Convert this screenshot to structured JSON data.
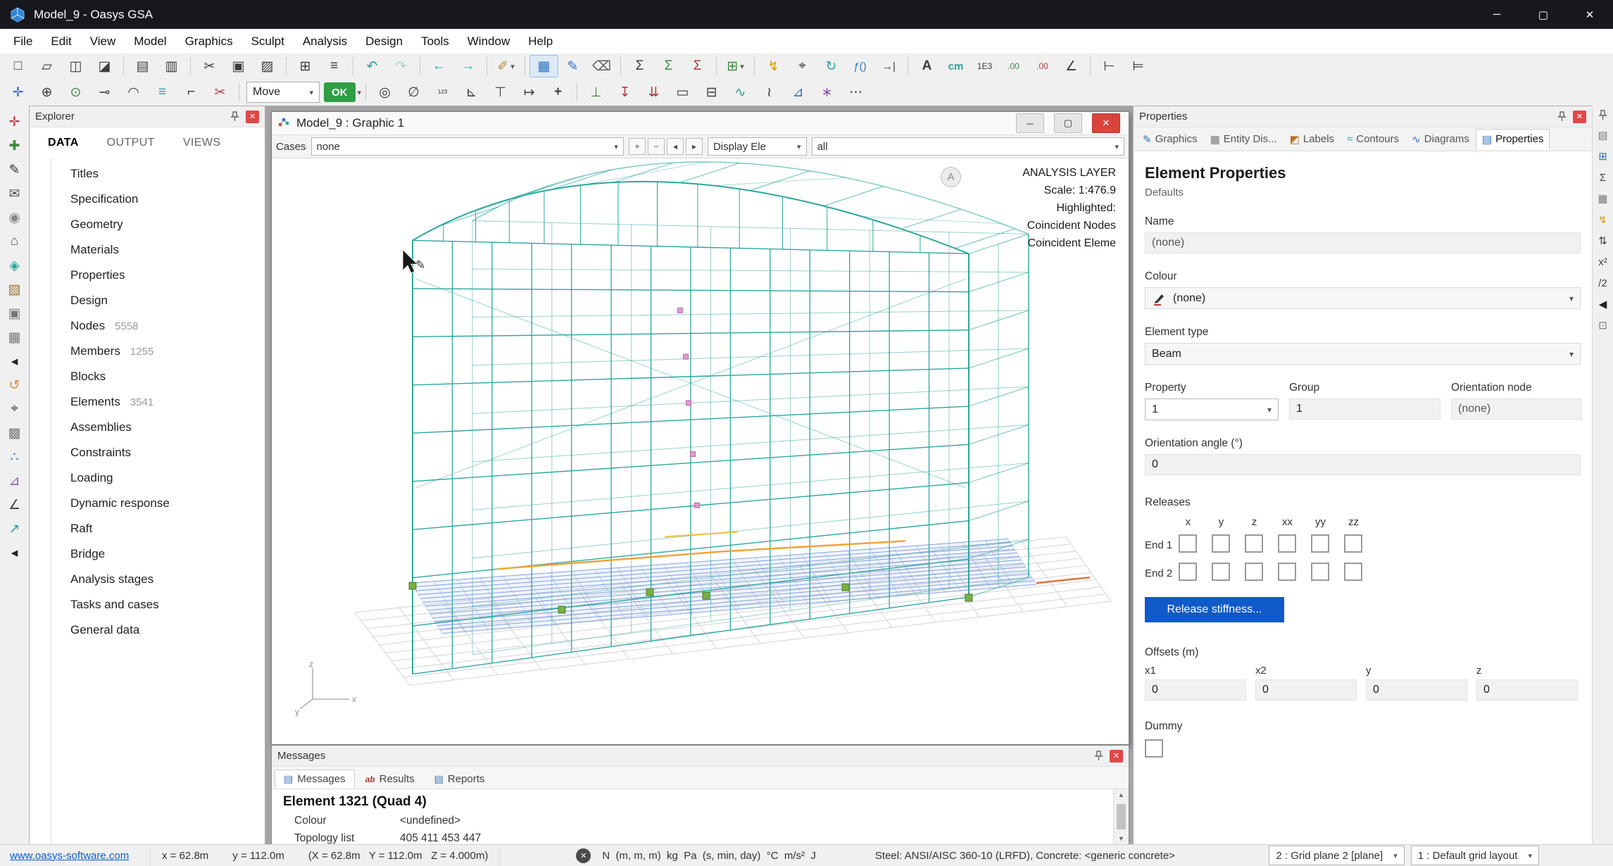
{
  "glyphs": {
    "dropdown": "▾",
    "expand": "▶",
    "close": "✕",
    "minimize": "─",
    "maximize": "▢",
    "scroll_up": "▲",
    "scroll_down": "▼"
  },
  "titlebar": {
    "title": "Model_9 - Oasys GSA"
  },
  "menubar": {
    "items": [
      "File",
      "Edit",
      "View",
      "Model",
      "Graphics",
      "Sculpt",
      "Analysis",
      "Design",
      "Tools",
      "Window",
      "Help"
    ]
  },
  "toolbar1": {
    "items": [
      {
        "name": "new-icon",
        "glyph": "□"
      },
      {
        "name": "open-icon",
        "glyph": "▱"
      },
      {
        "name": "save-icon",
        "glyph": "◫"
      },
      {
        "name": "save-all-icon",
        "glyph": "◪"
      },
      {
        "sep": true
      },
      {
        "name": "print-icon",
        "glyph": "▤"
      },
      {
        "name": "print-preview-icon",
        "glyph": "▥"
      },
      {
        "sep": true
      },
      {
        "name": "cut-icon",
        "glyph": "✂"
      },
      {
        "name": "copy-icon",
        "glyph": "▣"
      },
      {
        "name": "paste-icon",
        "glyph": "▨"
      },
      {
        "sep": true
      },
      {
        "name": "print-grid-icon",
        "glyph": "⊞"
      },
      {
        "name": "reports-icon",
        "glyph": "≡"
      },
      {
        "sep": true
      },
      {
        "name": "undo-icon",
        "glyph": "↶",
        "color": "#2aa49b"
      },
      {
        "name": "redo-icon",
        "glyph": "↷",
        "color": "#a9cfcb"
      },
      {
        "sep": true
      },
      {
        "name": "back-icon",
        "glyph": "←",
        "color": "#2aa49b"
      },
      {
        "name": "forward-icon",
        "glyph": "→",
        "color": "#2aa49b"
      },
      {
        "sep": true
      },
      {
        "name": "sweep-icon",
        "glyph": "✐",
        "color": "#b78a3c",
        "dd": true
      },
      {
        "sep": true
      },
      {
        "name": "table-view-icon",
        "glyph": "▦",
        "color": "#2f6fbe",
        "active": true
      },
      {
        "name": "draw-icon",
        "glyph": "✎",
        "color": "#2f6fbe"
      },
      {
        "name": "erase-icon",
        "glyph": "⌫",
        "color": "#555555"
      },
      {
        "sep": true
      },
      {
        "name": "sum-icon",
        "glyph": "Σ"
      },
      {
        "name": "sum-add-icon",
        "glyph": "Σ",
        "color": "#3c8a3c"
      },
      {
        "name": "sum-remove-icon",
        "glyph": "Σ",
        "color": "#b03a3a"
      },
      {
        "sep": true
      },
      {
        "name": "add-grid-icon",
        "glyph": "⊞",
        "color": "#3c8a3c",
        "dd": true
      },
      {
        "sep": true
      },
      {
        "name": "flash-icon",
        "glyph": "↯",
        "color": "#d99a00"
      },
      {
        "name": "find-icon",
        "glyph": "⌖"
      },
      {
        "name": "refresh-icon",
        "glyph": "↻",
        "color": "#2aa49b"
      },
      {
        "name": "function-icon",
        "glyph": "ƒ()",
        "size": 15,
        "color": "#2f6fbe"
      },
      {
        "name": "goto-end-icon",
        "glyph": "→|",
        "size": 15
      },
      {
        "sep": true
      },
      {
        "name": "font-icon",
        "glyph": "A",
        "bold": true
      },
      {
        "name": "units-cm-icon",
        "glyph": "cm",
        "size": 15,
        "color": "#2aa49b",
        "bold": true
      },
      {
        "name": "exponent-icon",
        "glyph": "1E3",
        "size": 12
      },
      {
        "name": "decimals-increase-icon",
        "glyph": ".00",
        "size": 12,
        "color": "#3c8a3c"
      },
      {
        "name": "decimals-decrease-icon",
        "glyph": ".00",
        "size": 12,
        "color": "#b03a3a"
      },
      {
        "name": "angle-units-icon",
        "glyph": "∠"
      },
      {
        "sep": true
      },
      {
        "name": "dock-left-icon",
        "glyph": "⊢"
      },
      {
        "name": "indent-icon",
        "glyph": "⊨"
      }
    ]
  },
  "toolbar2": {
    "move_label": "Move",
    "ok_label": "OK",
    "items_left": [
      {
        "name": "select-all-icon",
        "glyph": "✛",
        "color": "#2f6fbe"
      },
      {
        "name": "zoom-window-icon",
        "glyph": "⊕"
      },
      {
        "name": "add-node-icon",
        "glyph": "⊙",
        "color": "#3c8a3c"
      },
      {
        "name": "add-element-icon",
        "glyph": "⊸",
        "color": "#444444"
      },
      {
        "name": "add-arc-icon",
        "glyph": "◠",
        "color": "#444444"
      },
      {
        "name": "layers-icon",
        "glyph": "≡",
        "color": "#2aa49b"
      },
      {
        "name": "corner-snap-icon",
        "glyph": "⌐"
      },
      {
        "name": "trim-icon",
        "glyph": "✂",
        "color": "#b03a3a"
      },
      {
        "sep": true
      }
    ],
    "items_right": [
      {
        "sep": true
      },
      {
        "name": "origin-icon",
        "glyph": "◎"
      },
      {
        "name": "empty-set-icon",
        "glyph": "∅"
      },
      {
        "name": "renumber-icon",
        "glyph": "¹²³",
        "size": 13
      },
      {
        "name": "angle-measure-icon",
        "glyph": "⊾"
      },
      {
        "name": "tsquare-icon",
        "glyph": "⊤"
      },
      {
        "name": "extend-icon",
        "glyph": "↦"
      },
      {
        "name": "crosshair-icon",
        "glyph": "+",
        "bold": true
      },
      {
        "sep": true
      },
      {
        "name": "support-icon",
        "glyph": "⊥",
        "color": "#3c8a3c"
      },
      {
        "name": "load-down-icon",
        "glyph": "↧",
        "color": "#b03a3a"
      },
      {
        "name": "load-distributed-icon",
        "glyph": "⇊",
        "color": "#b03a3a"
      },
      {
        "name": "frame-icon",
        "glyph": "▭"
      },
      {
        "name": "remove-cell-icon",
        "glyph": "⊟"
      },
      {
        "name": "spring-icon",
        "glyph": "∿",
        "color": "#2aa49b"
      },
      {
        "name": "joint-icon",
        "glyph": "≀"
      },
      {
        "name": "rigid-link-icon",
        "glyph": "⊿",
        "color": "#2f6fbe"
      },
      {
        "name": "axes-icon",
        "glyph": "∗",
        "color": "#8a5ab0"
      },
      {
        "name": "more-tools-icon",
        "glyph": "⋯"
      }
    ]
  },
  "left_strip": [
    {
      "name": "modify-tool-icon",
      "glyph": "✛",
      "color": "#b03a3a"
    },
    {
      "name": "sculpt-tool-icon",
      "glyph": "✚",
      "color": "#3c8a3c"
    },
    {
      "name": "pencil-tool-icon",
      "glyph": "✎",
      "color": "#333333"
    },
    {
      "name": "mail-icon",
      "glyph": "✉",
      "color": "#555555"
    },
    {
      "name": "lock-icon",
      "glyph": "◉",
      "color": "#888888"
    },
    {
      "name": "home-icon",
      "glyph": "⌂",
      "color": "#555555"
    },
    {
      "name": "box-3d-icon",
      "glyph": "◈",
      "color": "#2aa49b"
    },
    {
      "name": "package-icon",
      "glyph": "▧",
      "color": "#a0722e"
    },
    {
      "name": "security-icon",
      "glyph": "▣",
      "color": "#777777"
    },
    {
      "name": "grid-tool-icon",
      "glyph": "▦",
      "color": "#777777"
    },
    {
      "name": "collapse-panel-icon",
      "glyph": "◂",
      "color": "#222222"
    },
    {
      "name": "rotate-view-icon",
      "glyph": "↺",
      "color": "#e08a2e"
    },
    {
      "name": "zoom-tool-icon",
      "glyph": "⌖",
      "color": "#444444"
    },
    {
      "name": "volume-icon",
      "glyph": "▩",
      "color": "#777777"
    },
    {
      "name": "nodes-tool-icon",
      "glyph": "∴",
      "color": "#2f6fbe"
    },
    {
      "name": "section-tool-icon",
      "glyph": "⊿",
      "color": "#8a5ab0"
    },
    {
      "name": "measure-icon",
      "glyph": "∠",
      "color": "#444444"
    },
    {
      "name": "pointer-ne-icon",
      "glyph": "↗",
      "color": "#2aa49b"
    },
    {
      "name": "collapse-panel2-icon",
      "glyph": "◂",
      "color": "#222222"
    }
  ],
  "right_strip": [
    {
      "name": "views-strip-icon",
      "glyph": "▤",
      "color": "#777777"
    },
    {
      "name": "grid-strip-icon",
      "glyph": "⊞",
      "color": "#2f6fbe"
    },
    {
      "name": "sum-strip-icon",
      "glyph": "Σ",
      "color": "#444444"
    },
    {
      "name": "table-strip-icon",
      "glyph": "▦",
      "color": "#777777"
    },
    {
      "name": "flash-strip-icon",
      "glyph": "↯",
      "color": "#d99a00"
    },
    {
      "name": "swap-strip-icon",
      "glyph": "⇅",
      "color": "#444444"
    },
    {
      "name": "x2-strip-icon",
      "glyph": "x²",
      "color": "#444444"
    },
    {
      "name": "half-strip-icon",
      "glyph": "/2",
      "color": "#444444"
    },
    {
      "name": "collapse-right-icon",
      "glyph": "◀",
      "color": "#222222"
    },
    {
      "name": "hash-strip-icon",
      "glyph": "⊡",
      "color": "#777777"
    }
  ],
  "explorer": {
    "title": "Explorer",
    "tabs": [
      "DATA",
      "OUTPUT",
      "VIEWS"
    ],
    "active_tab": "DATA",
    "items": [
      {
        "label": "Titles",
        "arrow": false
      },
      {
        "label": "Specification",
        "arrow": true
      },
      {
        "label": "Geometry",
        "arrow": true
      },
      {
        "label": "Materials",
        "arrow": true
      },
      {
        "label": "Properties",
        "arrow": true
      },
      {
        "label": "Design",
        "arrow": true
      },
      {
        "label": "Nodes",
        "arrow": false,
        "count": "5558"
      },
      {
        "label": "Members",
        "arrow": false,
        "count": "1255"
      },
      {
        "label": "Blocks",
        "arrow": false
      },
      {
        "label": "Elements",
        "arrow": false,
        "count": "3541"
      },
      {
        "label": "Assemblies",
        "arrow": false
      },
      {
        "label": "Constraints",
        "arrow": true
      },
      {
        "label": "Loading",
        "arrow": true
      },
      {
        "label": "Dynamic response",
        "arrow": true
      },
      {
        "label": "Raft",
        "arrow": true
      },
      {
        "label": "Bridge",
        "arrow": true
      },
      {
        "label": "Analysis stages",
        "arrow": true
      },
      {
        "label": "Tasks and cases",
        "arrow": true
      },
      {
        "label": "General data",
        "arrow": true
      }
    ]
  },
  "graphic_window": {
    "title": "Model_9 : Graphic 1",
    "cases_label": "Cases",
    "cases_value": "none",
    "nav_buttons": [
      "+",
      "−",
      "◂",
      "▸"
    ],
    "display_label": "Display Ele",
    "display_value": "all",
    "overlay": {
      "badge": "A",
      "layer": "ANALYSIS LAYER",
      "scale": "Scale: 1:476.9",
      "highlighted": "Highlighted:",
      "coincident_nodes": "Coincident Nodes",
      "coincident_elements": "Coincident Eleme"
    },
    "axis": {
      "x": "x",
      "y": "y",
      "z": "z"
    }
  },
  "model": {
    "colors": {
      "structure": "#2BA79D",
      "slab": "#5b86d8",
      "slab_fill": "#3f6fd1",
      "grid": "#cfcfcf",
      "highlight": "#f0a33a",
      "highlight_small": "#f0c03a",
      "highlight2": "#e2703a",
      "node": "#76b041",
      "node_border": "#4e7a2a",
      "marker": "#e09ad6",
      "marker_border": "#b36aa8"
    }
  },
  "messages": {
    "title": "Messages",
    "tabs": [
      {
        "label": "Messages",
        "icon": "doc",
        "active": true
      },
      {
        "label": "Results",
        "icon": "ab",
        "active": false
      },
      {
        "label": "Reports",
        "icon": "doc",
        "active": false
      }
    ],
    "heading": "Element 1321 (Quad 4)",
    "rows": [
      {
        "label": "Colour",
        "value": "<undefined>"
      },
      {
        "label": "Topology list",
        "value": "405 411 453 447"
      }
    ]
  },
  "properties": {
    "title": "Properties",
    "tabs": [
      {
        "label": "Graphics",
        "icon": "✎",
        "color": "#2f6fbe",
        "active": false
      },
      {
        "label": "Entity Dis...",
        "icon": "▦",
        "color": "#777777",
        "active": false
      },
      {
        "label": "Labels",
        "icon": "◩",
        "color": "#b5762a",
        "active": false
      },
      {
        "label": "Contours",
        "icon": "≈",
        "color": "#2aa49b",
        "active": false
      },
      {
        "label": "Diagrams",
        "icon": "∿",
        "color": "#2f6fbe",
        "active": false
      },
      {
        "label": "Properties",
        "icon": "▤",
        "color": "#2f6fbe",
        "active": true
      }
    ],
    "heading": "Element Properties",
    "subheading": "Defaults",
    "name_label": "Name",
    "name_value": "(none)",
    "colour_label": "Colour",
    "colour_value": "(none)",
    "element_type_label": "Element type",
    "element_type_value": "Beam",
    "property_label": "Property",
    "property_value": "1",
    "group_label": "Group",
    "group_value": "1",
    "orientation_node_label": "Orientation node",
    "orientation_node_value": "(none)",
    "orientation_angle_label": "Orientation angle (°)",
    "orientation_angle_value": "0",
    "releases_label": "Releases",
    "release_axes": [
      "x",
      "y",
      "z",
      "xx",
      "yy",
      "zz"
    ],
    "end1_label": "End 1",
    "end2_label": "End 2",
    "release_button": "Release stiffness...",
    "offsets_label": "Offsets (m)",
    "offset_fields": [
      {
        "label": "x1",
        "value": "0"
      },
      {
        "label": "x2",
        "value": "0"
      },
      {
        "label": "y",
        "value": "0"
      },
      {
        "label": "z",
        "value": "0"
      }
    ],
    "dummy_label": "Dummy"
  },
  "statusbar": {
    "link": "www.oasys-software.com",
    "coords": [
      "x = 62.8m",
      "y = 112.0m",
      "(X = 62.8m   Y = 112.0m   Z = 4.000m)"
    ],
    "units": "N  (m, m, m)  kg  Pa  (s, min, day)  °C  m/s²  J",
    "materials": "Steel: ANSI/AISC 360-10 (LRFD), Concrete: <generic concrete>",
    "grid_plane": "2 : Grid plane 2 [plane]",
    "grid_layout": "1 : Default grid layout"
  }
}
